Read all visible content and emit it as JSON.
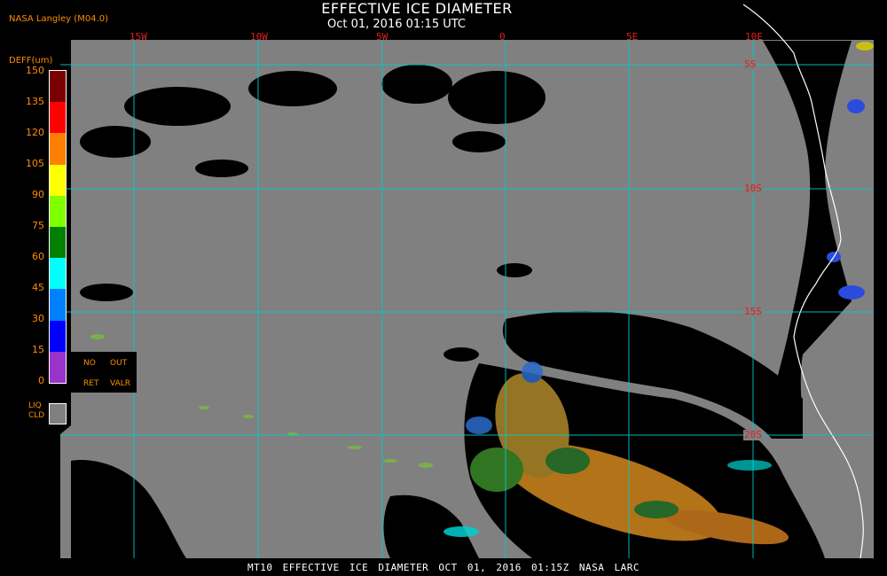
{
  "header": {
    "title": "EFFECTIVE ICE DIAMETER",
    "subtitle": "Oct 01, 2016 01:15 UTC",
    "source": "NASA Langley (M04.0)"
  },
  "map": {
    "lon_labels": [
      "15W",
      "10W",
      "5W",
      "0",
      "5E",
      "10E"
    ],
    "lat_labels": [
      "5S",
      "10S",
      "15S",
      "20S"
    ],
    "colors": {
      "cloud_liquid": "#808080",
      "background": "#000000",
      "grid": "#00cccc",
      "coast": "#ffffff",
      "label": "#dd2222"
    }
  },
  "legend": {
    "title": "DEFF(um)",
    "ticks": [
      "150",
      "135",
      "120",
      "105",
      "90",
      "75",
      "60",
      "45",
      "30",
      "15",
      "0"
    ],
    "colors": [
      "#7a0000",
      "#ff0000",
      "#ff8000",
      "#ffff00",
      "#80ff00",
      "#008000",
      "#00ffff",
      "#0080ff",
      "#0000ff",
      "#9933cc"
    ],
    "no_ret": {
      "no": "NO",
      "ret": "RET",
      "out": "OUT",
      "valr": "VALR"
    },
    "liq": {
      "line1": "LIQ",
      "line2": "CLD"
    }
  },
  "footer": {
    "text": "MT10  EFFECTIVE ICE DIAMETER  OCT 01, 2016 01:15Z  NASA LARC"
  }
}
